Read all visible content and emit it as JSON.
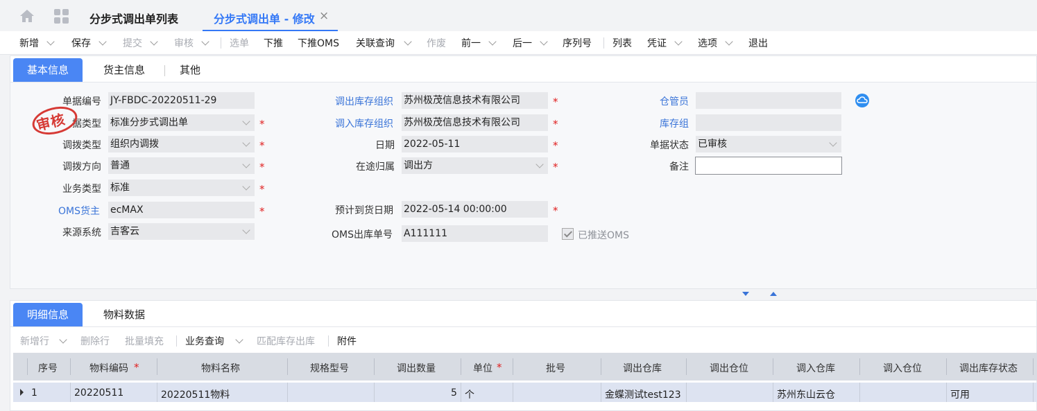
{
  "tabs": {
    "list_label": "分步式调出单列表",
    "active_label": "分步式调出单 - 修改",
    "close": "×"
  },
  "toolbar": {
    "items": [
      {
        "label": "新增",
        "enabled": true,
        "dropdown": true
      },
      {
        "label": "保存",
        "enabled": true,
        "dropdown": true
      },
      {
        "label": "提交",
        "enabled": false,
        "dropdown": true
      },
      {
        "label": "审核",
        "enabled": false,
        "dropdown": true
      },
      {
        "label": "选单",
        "enabled": false,
        "dropdown": false
      },
      {
        "label": "下推",
        "enabled": true,
        "dropdown": false
      },
      {
        "label": "下推OMS",
        "enabled": true,
        "dropdown": false
      },
      {
        "label": "关联查询",
        "enabled": true,
        "dropdown": true
      },
      {
        "label": "作废",
        "enabled": false,
        "dropdown": false
      },
      {
        "label": "前一",
        "enabled": true,
        "dropdown": true
      },
      {
        "label": "后一",
        "enabled": true,
        "dropdown": true
      },
      {
        "label": "序列号",
        "enabled": true,
        "dropdown": false
      },
      {
        "label": "列表",
        "enabled": true,
        "dropdown": false
      },
      {
        "label": "凭证",
        "enabled": true,
        "dropdown": true
      },
      {
        "label": "选项",
        "enabled": true,
        "dropdown": true
      },
      {
        "label": "退出",
        "enabled": true,
        "dropdown": false
      }
    ]
  },
  "header_tabs": [
    "基本信息",
    "货主信息",
    "其他"
  ],
  "form": {
    "bill_no_label": "单据编号",
    "bill_no": "JY-FBDC-20220511-29",
    "bill_type_label": "据类型",
    "bill_type": "标准分步式调出单",
    "transfer_type_label": "调拨类型",
    "transfer_type": "组织内调拨",
    "direction_label": "调拨方向",
    "direction": "普通",
    "biz_type_label": "业务类型",
    "biz_type": "标准",
    "oms_owner_label": "OMS货主",
    "oms_owner": "ecMAX",
    "source_system_label": "来源系统",
    "source_system": "吉客云",
    "out_org_label": "调出库存组织",
    "out_org": "苏州极茂信息技术有限公司",
    "in_org_label": "调入库存组织",
    "in_org": "苏州极茂信息技术有限公司",
    "date_label": "日期",
    "date": "2022-05-11",
    "transit_label": "在途归属",
    "transit": "调出方",
    "eta_label": "预计到货日期",
    "eta": "2022-05-14 00:00:00",
    "oms_out_no_label": "OMS出库单号",
    "oms_out_no": "A111111",
    "pushed_oms_label": "已推送OMS",
    "pushed_oms": true,
    "keeper_label": "仓管员",
    "keeper": "",
    "stock_group_label": "库存组",
    "stock_group": "",
    "status_label": "单据状态",
    "status": "已审核",
    "remark_label": "备注",
    "remark": ""
  },
  "stamp": {
    "text": "审核",
    "color": "#d63a35"
  },
  "detail_tabs": [
    "明细信息",
    "物料数据"
  ],
  "detail_toolbar": [
    {
      "label": "新增行",
      "enabled": false,
      "dropdown": true
    },
    {
      "label": "删除行",
      "enabled": false,
      "dropdown": false
    },
    {
      "label": "批量填充",
      "enabled": false,
      "dropdown": false
    },
    {
      "label": "业务查询",
      "enabled": true,
      "dropdown": true
    },
    {
      "label": "匹配库存出库",
      "enabled": false,
      "dropdown": false
    },
    {
      "label": "附件",
      "enabled": true,
      "dropdown": false
    }
  ],
  "grid": {
    "columns": [
      "序号",
      "物料编码",
      "物料名称",
      "规格型号",
      "调出数量",
      "单位",
      "批号",
      "调出仓库",
      "调出仓位",
      "调入仓库",
      "调入仓位",
      "调出库存状态"
    ],
    "required_columns": [
      "物料编码",
      "单位"
    ],
    "rows": [
      {
        "seq": "1",
        "material_code": "20220511",
        "material_name": "20220511物料",
        "spec": "",
        "qty": "5",
        "unit": "个",
        "lot": "",
        "out_wh": "金蝶测试test123",
        "out_loc": "",
        "in_wh": "苏州东山云仓",
        "in_loc": "",
        "out_status": "可用"
      }
    ]
  },
  "colors": {
    "accent": "#4a86f4",
    "link": "#3a74d8",
    "required": "#e02020"
  }
}
